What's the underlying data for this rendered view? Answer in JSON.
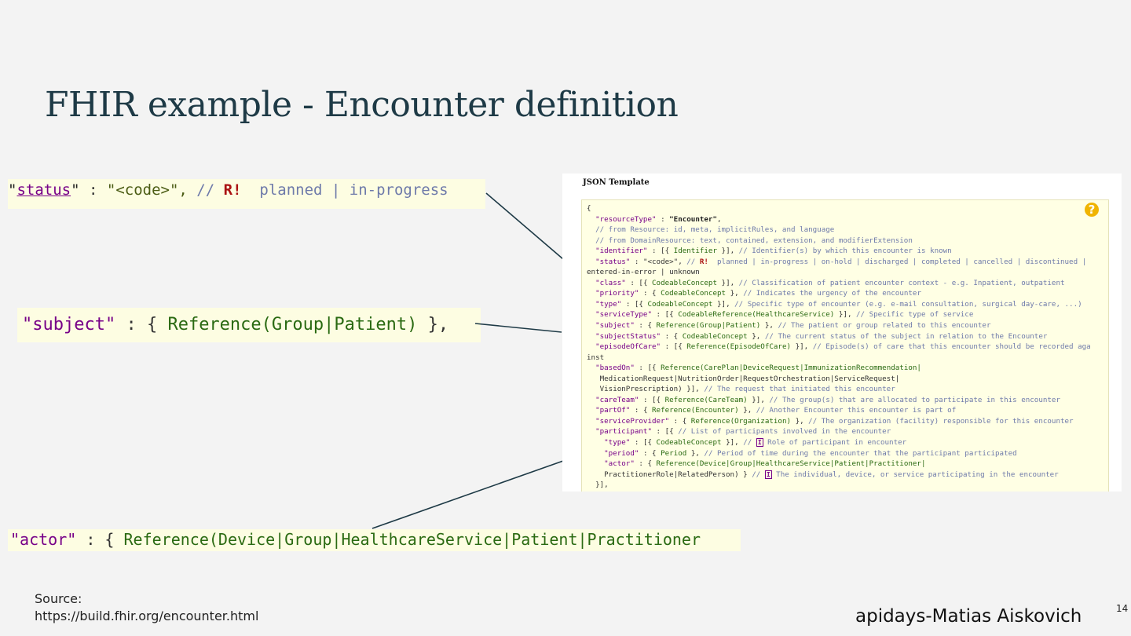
{
  "slide": {
    "title": "FHIR example - Encounter definition",
    "source_label": "Source:",
    "source_url": "https://build.fhir.org/encounter.html",
    "author": "apidays-Matias Aiskovich",
    "page_number": "14"
  },
  "snippets": {
    "status": {
      "key": "status",
      "value": "\"<code>\",",
      "comment_slashes": "//",
      "required": "R!",
      "values_text": "planned | in-progress"
    },
    "subject": {
      "key": "\"subject\"",
      "sep": " : { ",
      "ref": "Reference(Group|Patient)",
      "close": " },"
    },
    "actor": {
      "key": "\"actor\"",
      "sep": " : { ",
      "ref": "Reference(Device|Group|HealthcareService|Patient|Practitioner"
    }
  },
  "panel": {
    "heading": "JSON Template",
    "help_icon": "help-question-icon",
    "lines": [
      "{",
      "  \"resourceType\" : \"Encounter\",",
      "  // from Resource: id, meta, implicitRules, and language",
      "  // from DomainResource: text, contained, extension, and modifierExtension",
      "  \"identifier\" : [{ Identifier }], // Identifier(s) by which this encounter is known",
      "  \"status\" : \"<code>\", // R!  planned | in-progress | on-hold | discharged | completed | cancelled | discontinued |",
      "entered-in-error | unknown",
      "  \"class\" : [{ CodeableConcept }], // Classification of patient encounter context - e.g. Inpatient, outpatient",
      "  \"priority\" : { CodeableConcept }, // Indicates the urgency of the encounter",
      "  \"type\" : [{ CodeableConcept }], // Specific type of encounter (e.g. e-mail consultation, surgical day-care, ...)",
      "  \"serviceType\" : [{ CodeableReference(HealthcareService) }], // Specific type of service",
      "  \"subject\" : { Reference(Group|Patient) }, // The patient or group related to this encounter",
      "  \"subjectStatus\" : { CodeableConcept }, // The current status of the subject in relation to the Encounter",
      "  \"episodeOfCare\" : [{ Reference(EpisodeOfCare) }], // Episode(s) of care that this encounter should be recorded aga",
      "inst",
      "  \"basedOn\" : [{ Reference(CarePlan|DeviceRequest|ImmunizationRecommendation|",
      "   MedicationRequest|NutritionOrder|RequestOrchestration|ServiceRequest|",
      "   VisionPrescription) }], // The request that initiated this encounter",
      "  \"careTeam\" : [{ Reference(CareTeam) }], // The group(s) that are allocated to participate in this encounter",
      "  \"partOf\" : { Reference(Encounter) }, // Another Encounter this encounter is part of",
      "  \"serviceProvider\" : { Reference(Organization) }, // The organization (facility) responsible for this encounter",
      "  \"participant\" : [{ // List of participants involved in the encounter",
      "    \"type\" : [{ CodeableConcept }], // I Role of participant in encounter",
      "    \"period\" : { Period }, // Period of time during the encounter that the participant participated",
      "    \"actor\" : { Reference(Device|Group|HealthcareService|Patient|Practitioner|",
      "    PractitionerRole|RelatedPerson) } // I The individual, device, or service participating in the encounter",
      "  }],"
    ]
  },
  "colors": {
    "title": "#1e3a46",
    "background": "#f3f3f3",
    "snippet_bg": "#fdfde2",
    "key": "#770088",
    "reference": "#2a6a12",
    "comment": "#6e7aaa",
    "required": "#aa1111",
    "connector": "#1e3a46"
  }
}
